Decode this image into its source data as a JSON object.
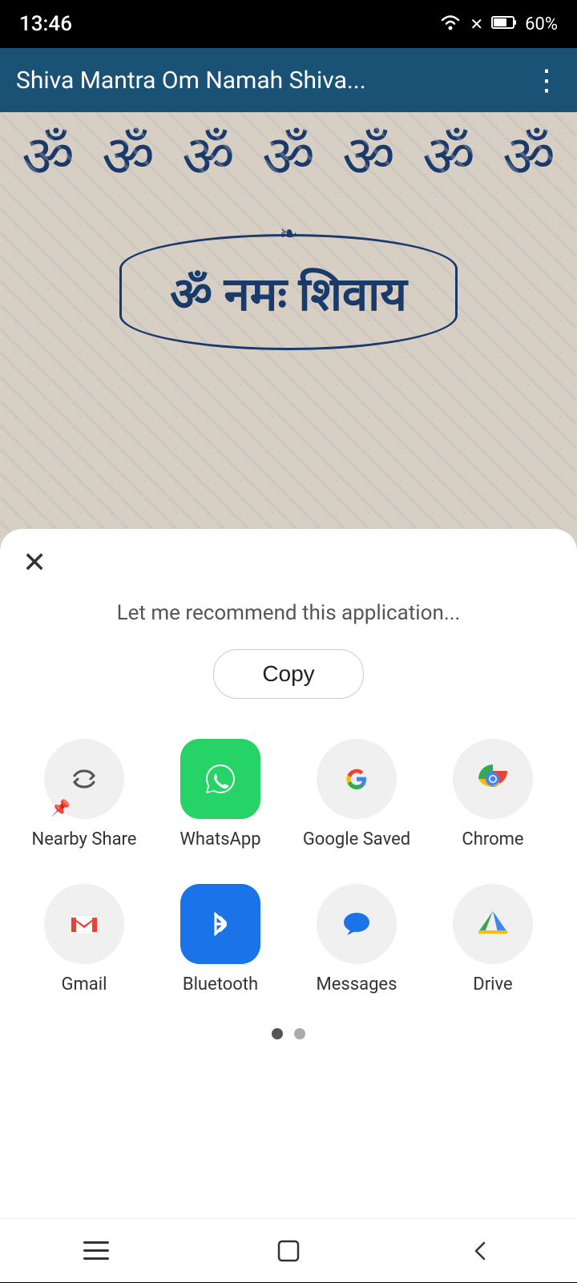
{
  "statusBar": {
    "time": "13:46",
    "battery": "60%"
  },
  "appBar": {
    "title": "Shiva Mantra Om Namah Shiva...",
    "menuIcon": "⋮"
  },
  "contentArea": {
    "omSymbols": [
      "ॐ",
      "ॐ",
      "ॐ",
      "ॐ",
      "ॐ",
      "ॐ",
      "ॐ"
    ],
    "mantraText": "ॐ नमः शिवाय"
  },
  "shareSheet": {
    "closeLabel": "✕",
    "shareText": "Let me recommend this application...",
    "copyLabel": "Copy",
    "apps": [
      {
        "name": "Nearby Share",
        "type": "nearby"
      },
      {
        "name": "WhatsApp",
        "type": "whatsapp"
      },
      {
        "name": "Google Saved",
        "type": "google"
      },
      {
        "name": "Chrome",
        "type": "chrome"
      },
      {
        "name": "Gmail",
        "type": "gmail"
      },
      {
        "name": "Bluetooth",
        "type": "bluetooth"
      },
      {
        "name": "Messages",
        "type": "messages"
      },
      {
        "name": "Drive",
        "type": "drive"
      }
    ],
    "pageIndicators": [
      true,
      false
    ]
  },
  "navBar": {
    "menuIcon": "≡",
    "homeIcon": "□",
    "backIcon": "◁"
  }
}
